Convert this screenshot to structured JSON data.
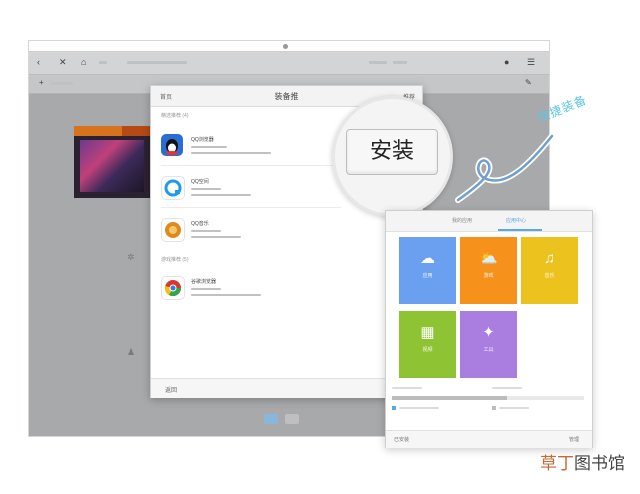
{
  "dialog": {
    "title": "装备推",
    "back_label": "首页",
    "right_label": "推荐",
    "section1_label": "精选推荐 (4)",
    "section2_label": "游戏推荐 (5)",
    "apps": [
      {
        "name": "QQ浏览器",
        "icon": "penguin-icon",
        "color": "#2b6cd4"
      },
      {
        "name": "QQ空间",
        "icon": "qzone-icon",
        "color": "#1e9be8"
      },
      {
        "name": "QQ音乐",
        "icon": "music-icon",
        "color": "#e08a1e"
      },
      {
        "name": "谷歌浏览器",
        "icon": "chrome-icon",
        "color": "#d8382b"
      }
    ],
    "footer_label": "返回"
  },
  "magnifier": {
    "install_label": "安装"
  },
  "handwritten_note": "快捷装备",
  "phone": {
    "tab1": "我的应用",
    "tab2": "应用中心",
    "tiles": [
      {
        "label": "应用",
        "icon": "cloud-icon",
        "symbol": "☁",
        "color": "#6b9ff0"
      },
      {
        "label": "游戏",
        "icon": "weather-icon",
        "symbol": "⛅",
        "color": "#f6911c"
      },
      {
        "label": "音乐",
        "icon": "music-note-icon",
        "symbol": "♫",
        "color": "#ecc21f"
      },
      {
        "label": "视频",
        "icon": "film-icon",
        "symbol": "▦",
        "color": "#8ec334"
      },
      {
        "label": "工具",
        "icon": "pin-icon",
        "symbol": "✦",
        "color": "#a97ee0"
      }
    ],
    "progress": 0.6,
    "footer_label": "已安装",
    "footer_right": "管理"
  },
  "watermark": {
    "part1": "草丁",
    "part2": "图书馆"
  }
}
